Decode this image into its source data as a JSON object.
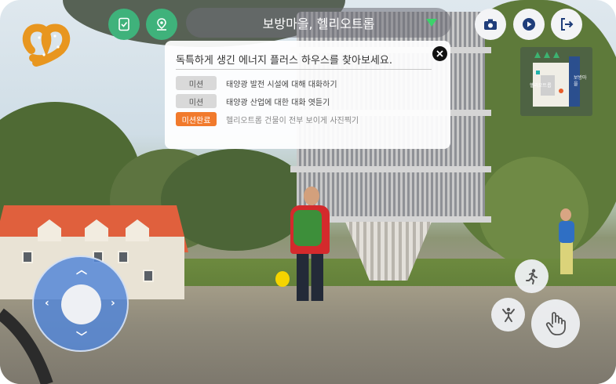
{
  "header": {
    "location_title": "보방마을, 헬리오트롭"
  },
  "toolbar": {
    "left_icons": [
      "checklist-icon",
      "location-pin-icon"
    ],
    "right_icons": [
      "camera-icon",
      "play-icon",
      "exit-icon"
    ]
  },
  "mission_panel": {
    "heading": "독특하게 생긴 에너지 플러스 하우스를 찾아보세요.",
    "missions": [
      {
        "badge": "미션",
        "text": "태양광 발전 시설에 대해 대화하기",
        "status": "pending"
      },
      {
        "badge": "미션",
        "text": "태양광 산업에 대한 대화 엿듣기",
        "status": "pending"
      },
      {
        "badge": "미션완료",
        "text": "헬리오트롭 건물이 전부 보이게 사진찍기",
        "status": "completed"
      }
    ]
  },
  "minimap": {
    "labels": [
      "헬리오트롭",
      "보방마을"
    ]
  },
  "colors": {
    "green_button": "#3fb27b",
    "completed_badge": "#f17a2c",
    "pending_badge": "#d9d9d9",
    "joystick": "#5587d7"
  }
}
